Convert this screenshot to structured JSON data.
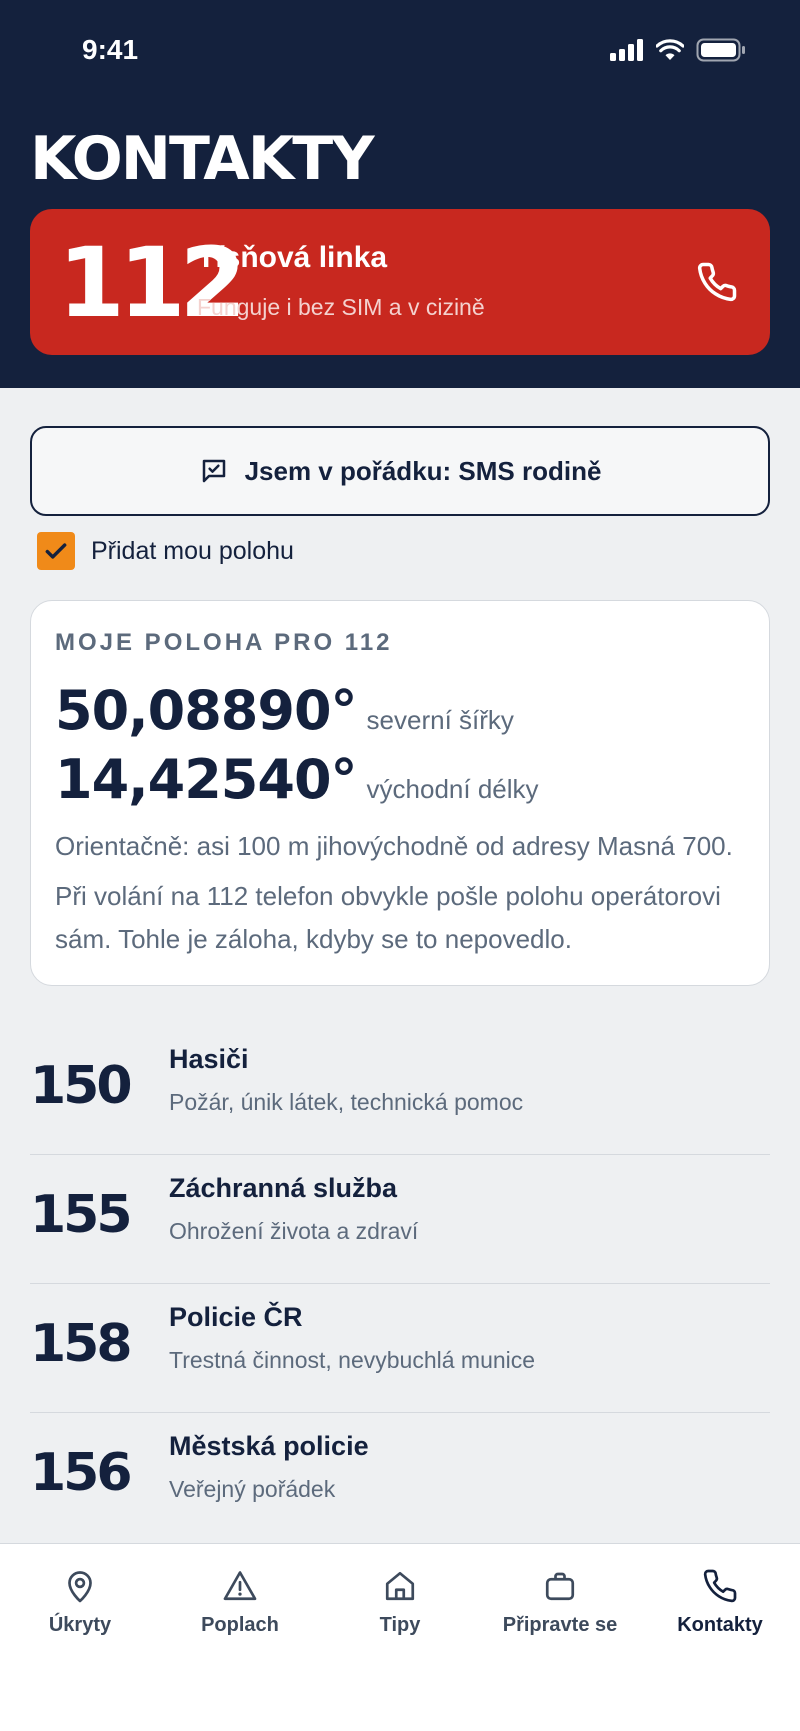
{
  "status_bar": {
    "time": "9:41",
    "icons": [
      "signal-icon",
      "wifi-icon",
      "battery-icon"
    ]
  },
  "page": {
    "title": "KONTAKTY"
  },
  "emergency": {
    "number": "112",
    "title": "Tísňová linka",
    "subtitle": "Funguje i bez SIM a v cizině",
    "icon": "phone-icon",
    "color": "#c8281f"
  },
  "sms_button": {
    "label": "Jsem v pořádku: SMS rodině",
    "icon": "message-icon"
  },
  "location_toggle": {
    "label": "Přidat mou polohu",
    "checked": true,
    "color": "#f08a19"
  },
  "location_card": {
    "heading": "MOJE POLOHA PRO 112",
    "latitude": {
      "value": "50,08890°",
      "label": "severní šířky"
    },
    "longitude": {
      "value": "14,42540°",
      "label": "východní délky"
    },
    "approx": "Orientačně: asi 100 m jihovýchodně od adresy Masná 700.",
    "note_line1": "Při volání na 112 telefon obvykle pošle polohu operátorovi",
    "note_line2": "sám. Tohle je záloha, kdyby se to nepovedlo."
  },
  "contacts": [
    {
      "number": "150",
      "title": "Hasiči",
      "description": "Požár, únik látek, technická pomoc"
    },
    {
      "number": "155",
      "title": "Záchranná služba",
      "description": "Ohrožení života a zdraví"
    },
    {
      "number": "158",
      "title": "Policie ČR",
      "description": "Trestná činnost, nevybuchlá munice"
    },
    {
      "number": "156",
      "title": "Městská policie",
      "description": "Veřejný pořádek"
    }
  ],
  "tabs": [
    {
      "label": "Úkryty",
      "icon": "map-pin-icon"
    },
    {
      "label": "Poplach",
      "icon": "warning-icon"
    },
    {
      "label": "Tipy",
      "icon": "home-icon"
    },
    {
      "label": "Připravte se",
      "icon": "bag-icon"
    },
    {
      "label": "Kontakty",
      "icon": "phone-icon",
      "active": true
    }
  ],
  "colors": {
    "navy": "#14213d",
    "red": "#c8281f",
    "orange": "#f08a19",
    "background": "#eef0f2"
  }
}
